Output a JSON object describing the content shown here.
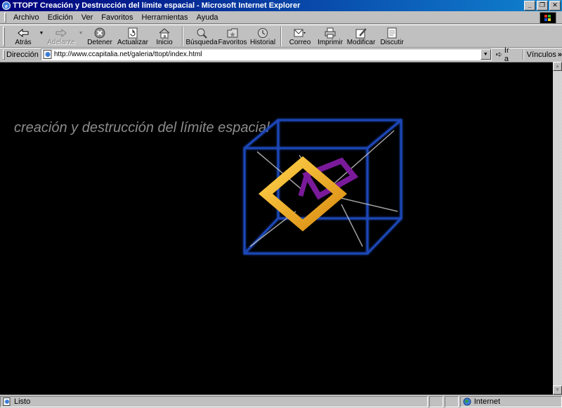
{
  "window": {
    "title": "TTOPT Creación y Destrucción del límite espacial - Microsoft Internet Explorer"
  },
  "menu": [
    {
      "label": "Archivo",
      "name": "menu-archivo"
    },
    {
      "label": "Edición",
      "name": "menu-edicion"
    },
    {
      "label": "Ver",
      "name": "menu-ver"
    },
    {
      "label": "Favoritos",
      "name": "menu-favoritos"
    },
    {
      "label": "Herramientas",
      "name": "menu-herramientas"
    },
    {
      "label": "Ayuda",
      "name": "menu-ayuda"
    }
  ],
  "toolbar": {
    "back": "Atrás",
    "forward": "Adelante",
    "stop": "Detener",
    "refresh": "Actualizar",
    "home": "Inicio",
    "search": "Búsqueda",
    "favorites": "Favoritos",
    "history": "Historial",
    "mail": "Correo",
    "print": "Imprimir",
    "edit": "Modificar",
    "discuss": "Discutir"
  },
  "address": {
    "label": "Dirección",
    "url": "http://www.ccapitalia.net/galeria/ttopt/index.html",
    "go": "Ir a",
    "links": "Vínculos"
  },
  "page": {
    "heading": "creación y destrucción del límite espacial"
  },
  "status": {
    "text": "Listo",
    "zone": "Internet"
  },
  "colors": {
    "titlebar_start": "#00007b",
    "titlebar_end": "#1084d0",
    "cube": "#1a3fa8",
    "diamond": "#f0b020",
    "purple": "#7a1a9a",
    "heading": "#8c8c8c"
  }
}
